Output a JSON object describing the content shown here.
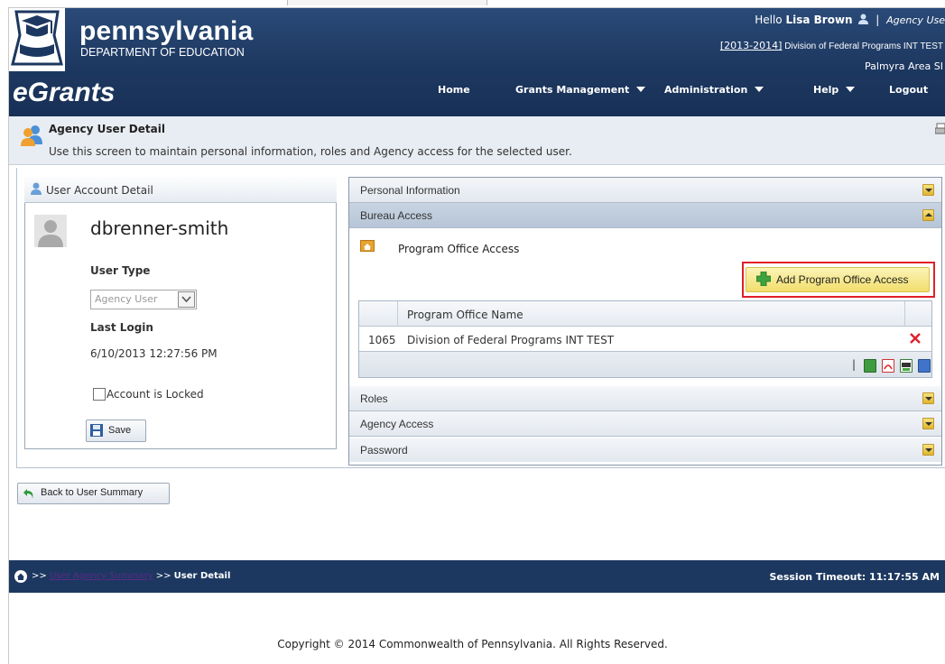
{
  "header": {
    "logo_name": "pennsylvania",
    "logo_dept": "DEPARTMENT OF EDUCATION",
    "app_name": "eGrants",
    "greeting_prefix": "Hello",
    "user_name": "Lisa Brown",
    "separator": "|",
    "role": "Agency Use",
    "fiscal_year": "[2013-2014]",
    "division": "Division of Federal Programs INT TEST",
    "district": "Palmyra Area SI"
  },
  "nav": {
    "home": "Home",
    "grants": "Grants Management",
    "admin": "Administration",
    "help": "Help",
    "logout": "Logout"
  },
  "page": {
    "title": "Agency User Detail",
    "description": "Use this screen to maintain personal information, roles and Agency access for the selected user."
  },
  "user_panel": {
    "title": "User Account Detail",
    "username": "dbrenner-smith",
    "user_type_label": "User Type",
    "user_type_value": "Agency User",
    "last_login_label": "Last Login",
    "last_login_value": "6/10/2013 12:27:56 PM",
    "locked_label": "Account is Locked",
    "save_label": "Save"
  },
  "accordion": {
    "personal": "Personal Information",
    "bureau": "Bureau Access",
    "roles": "Roles",
    "agency": "Agency Access",
    "password": "Password"
  },
  "program_office": {
    "title": "Program Office Access",
    "add_label": "Add Program Office Access",
    "column_name": "Program Office Name",
    "rows": [
      {
        "id": "1065",
        "name": "Division of Federal Programs INT TEST"
      }
    ],
    "footer_sep": "|"
  },
  "back_label": "Back to User Summary",
  "breadcrumb": {
    "sep1": ">>",
    "link": "User Agency Summary",
    "sep2": ">>",
    "current": "User Detail"
  },
  "session": "Session Timeout: 11:17:55 AM",
  "copyright": "Copyright © 2014 Commonwealth of Pennsylvania. All Rights Reserved.",
  "colors": {
    "header_navy": "#1d3860",
    "accent_red": "#e0202a",
    "button_yellow": "#f2de6c",
    "link_purple": "#5a2a8a"
  }
}
